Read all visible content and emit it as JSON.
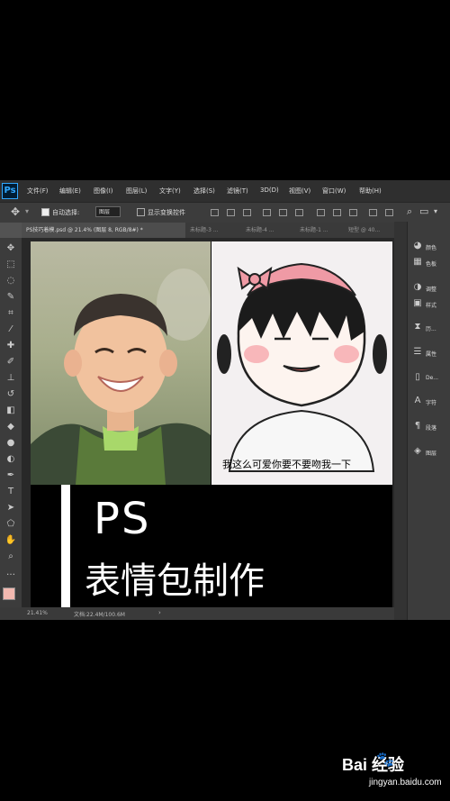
{
  "app": {
    "logo": "Ps"
  },
  "menu": [
    "文件(F)",
    "编辑(E)",
    "图像(I)",
    "图层(L)",
    "文字(Y)",
    "选择(S)",
    "滤镜(T)",
    "3D(D)",
    "视图(V)",
    "窗口(W)",
    "帮助(H)"
  ],
  "options": {
    "auto_select": "自动选择:",
    "select_value": "图层",
    "show_transform": "显示变换控件"
  },
  "tabs": [
    "PS技巧着模.psd @ 21.4% (图层 8, RGB/8#) *",
    "未标题-3 ...",
    "未标题-4 ...",
    "未标题-1 ...",
    "短型 @ 40..."
  ],
  "status": {
    "zoom": "21.41%",
    "doc": "文档:22.4M/100.6M"
  },
  "panels": [
    {
      "icon": "color-icon",
      "label": "颜色"
    },
    {
      "icon": "swatches-icon",
      "label": "色板"
    },
    {
      "icon": "adjustments-icon",
      "label": "调整"
    },
    {
      "icon": "styles-icon",
      "label": "样式"
    },
    {
      "icon": "history-icon",
      "label": "历..."
    },
    {
      "icon": "properties-icon",
      "label": "属性"
    },
    {
      "icon": "device-icon",
      "label": "De..."
    },
    {
      "icon": "character-icon",
      "label": "字符"
    },
    {
      "icon": "paragraph-icon",
      "label": "段落"
    },
    {
      "icon": "layers-icon",
      "label": "图层"
    }
  ],
  "canvas": {
    "caption": "我这么可爱你要不要吻我一下",
    "title": "PS",
    "subtitle": "表情包制作"
  },
  "watermark": {
    "brand": "Bai  经验",
    "url": "jingyan.baidu.com"
  }
}
